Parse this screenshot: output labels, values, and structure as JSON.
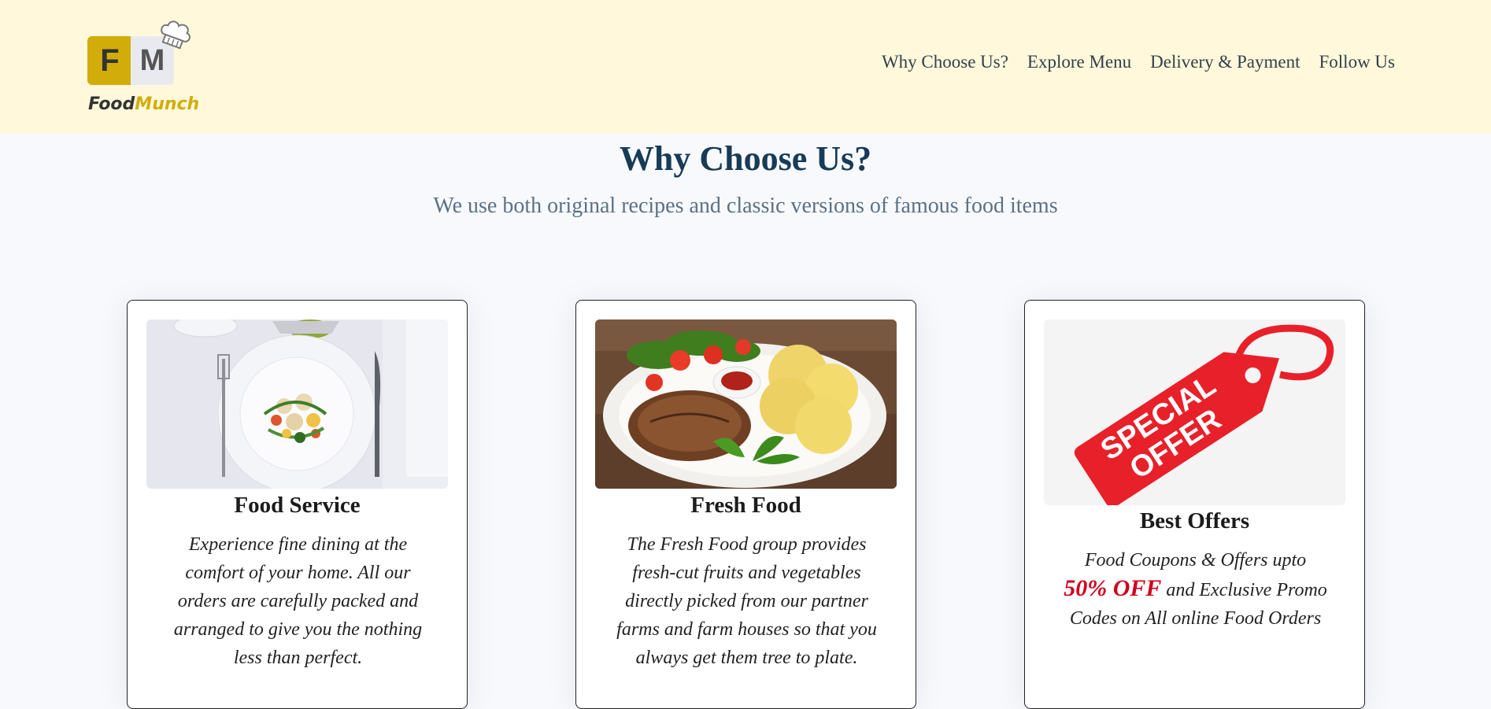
{
  "brand": {
    "logo_letter_f": "F",
    "logo_letter_m": "M",
    "name_part1": "Food",
    "name_part2": "Munch",
    "accent_color": "#d2ad0a"
  },
  "nav": {
    "links": [
      "Why Choose Us?",
      "Explore Menu",
      "Delivery & Payment",
      "Follow Us"
    ]
  },
  "section": {
    "title": "Why Choose Us?",
    "subtitle": "We use both original recipes and classic versions of famous food items"
  },
  "cards": [
    {
      "title": "Food Service",
      "text": "Experience fine dining at the comfort of your home. All our orders are carefully packed and arranged to give you the nothing less than perfect."
    },
    {
      "title": "Fresh Food",
      "text": "The Fresh Food group provides fresh-cut fruits and vegetables directly picked from our partner farms and farm houses so that you always get them tree to plate."
    },
    {
      "title": "Best Offers",
      "text_before": "Food Coupons & Offers upto",
      "highlight": "50% OFF",
      "text_after": "and Exclusive Promo Codes on All online Food Orders",
      "tag_line1": "SPECIAL",
      "tag_line2": "OFFER"
    }
  ],
  "colors": {
    "navbar_bg": "#fff8da",
    "heading": "#183b56",
    "subtext": "#5a7184",
    "offer_red": "#e8202a"
  }
}
